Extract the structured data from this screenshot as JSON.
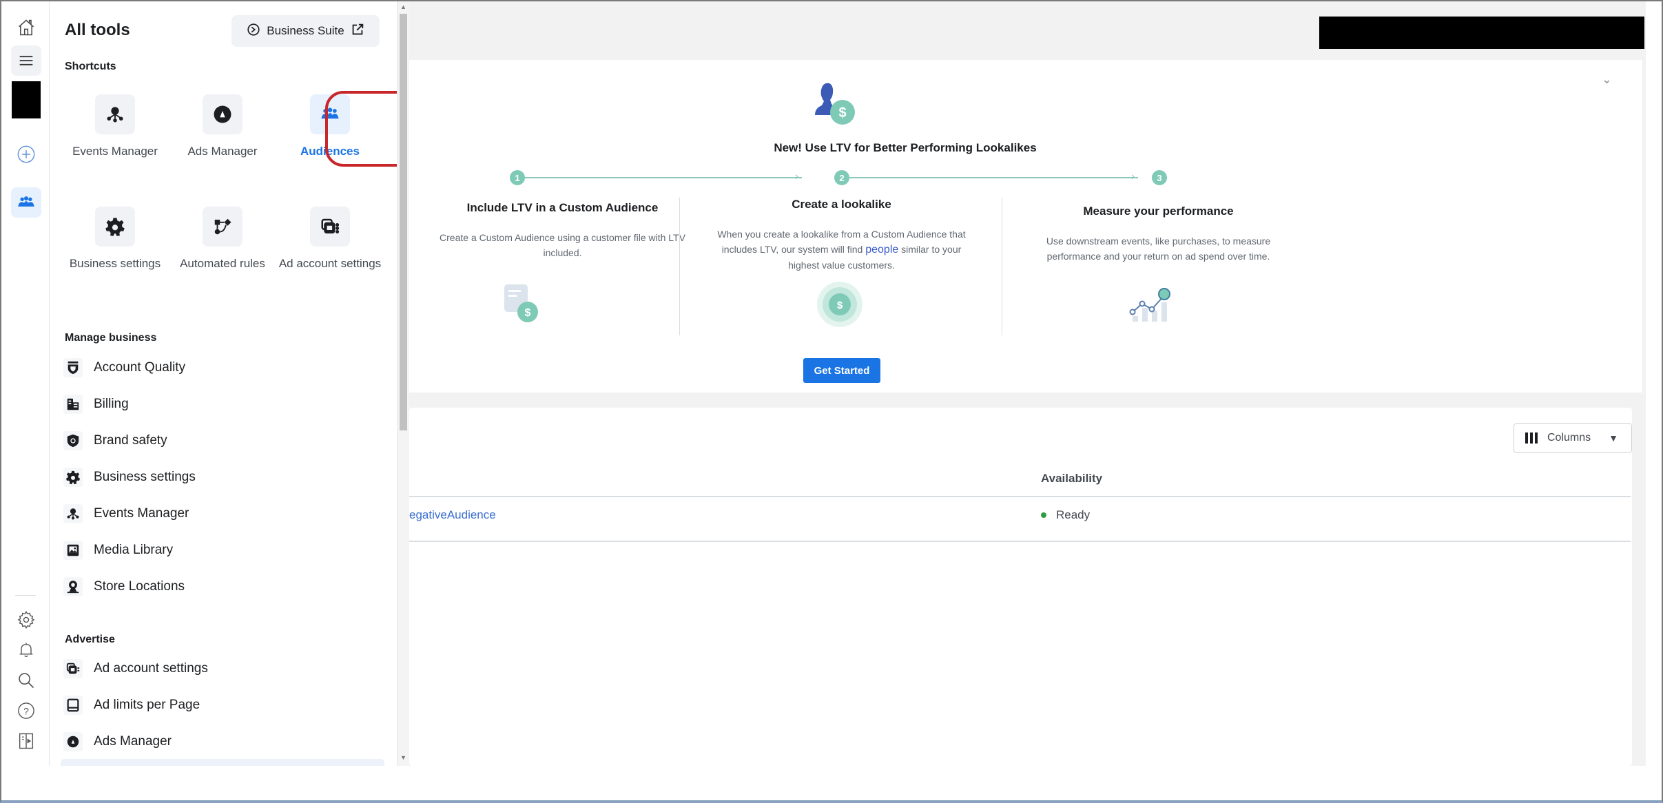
{
  "rail": {
    "icons": [
      "home-icon",
      "menu-icon",
      "create-icon",
      "audiences-icon",
      "settings-icon",
      "notifications-icon",
      "search-icon",
      "help-icon",
      "collapse-panel-icon"
    ]
  },
  "panel": {
    "title": "All tools",
    "business_suite_label": "Business Suite",
    "shortcuts_title": "Shortcuts",
    "shortcuts": [
      {
        "label": "Events Manager",
        "icon": "events-manager-icon",
        "active": false
      },
      {
        "label": "Ads Manager",
        "icon": "ads-manager-icon",
        "active": false
      },
      {
        "label": "Audiences",
        "icon": "audiences-icon",
        "active": true
      },
      {
        "label": "Business settings",
        "icon": "gear-icon",
        "active": false
      },
      {
        "label": "Automated rules",
        "icon": "automated-rules-icon",
        "active": false
      },
      {
        "label": "Ad account settings",
        "icon": "ad-account-icon",
        "active": false
      }
    ],
    "manage_title": "Manage business",
    "manage_items": [
      {
        "label": "Account Quality",
        "icon": "shield-check-icon"
      },
      {
        "label": "Billing",
        "icon": "billing-icon"
      },
      {
        "label": "Brand safety",
        "icon": "brand-safety-icon"
      },
      {
        "label": "Business settings",
        "icon": "gear-icon"
      },
      {
        "label": "Events Manager",
        "icon": "events-manager-icon"
      },
      {
        "label": "Media Library",
        "icon": "media-library-icon"
      },
      {
        "label": "Store Locations",
        "icon": "store-location-icon"
      }
    ],
    "advertise_title": "Advertise",
    "advertise_items": [
      {
        "label": "Ad account settings",
        "icon": "ad-account-icon"
      },
      {
        "label": "Ad limits per Page",
        "icon": "ad-limits-icon"
      },
      {
        "label": "Ads Manager",
        "icon": "ads-manager-icon"
      }
    ]
  },
  "banner": {
    "title": "New! Use LTV for Better Performing Lookalikes",
    "steps": [
      {
        "number": "1",
        "title": "Include LTV in a Custom Audience",
        "text": "Create a Custom Audience using a customer file with LTV included."
      },
      {
        "number": "2",
        "title": "Create a lookalike",
        "text_before": "When you create a lookalike from a Custom Audience that includes LTV, our system will find ",
        "link": "people",
        "text_after": " similar to your highest value customers."
      },
      {
        "number": "3",
        "title": "Measure your performance",
        "text": "Use downstream events, like purchases, to measure performance and your return on ad spend over time."
      }
    ],
    "cta_label": "Get Started"
  },
  "table": {
    "columns_button_label": "Columns",
    "headers": {
      "availability": "Availability"
    },
    "rows": [
      {
        "name": "egativeAudience",
        "availability": "Ready"
      }
    ],
    "colors": {
      "ready": "#2e9b3f",
      "link": "#3b6fd1"
    }
  },
  "colors": {
    "accent": "#1b74e4",
    "highlight_ring": "#c8262a",
    "teal": "#7fcab7"
  }
}
